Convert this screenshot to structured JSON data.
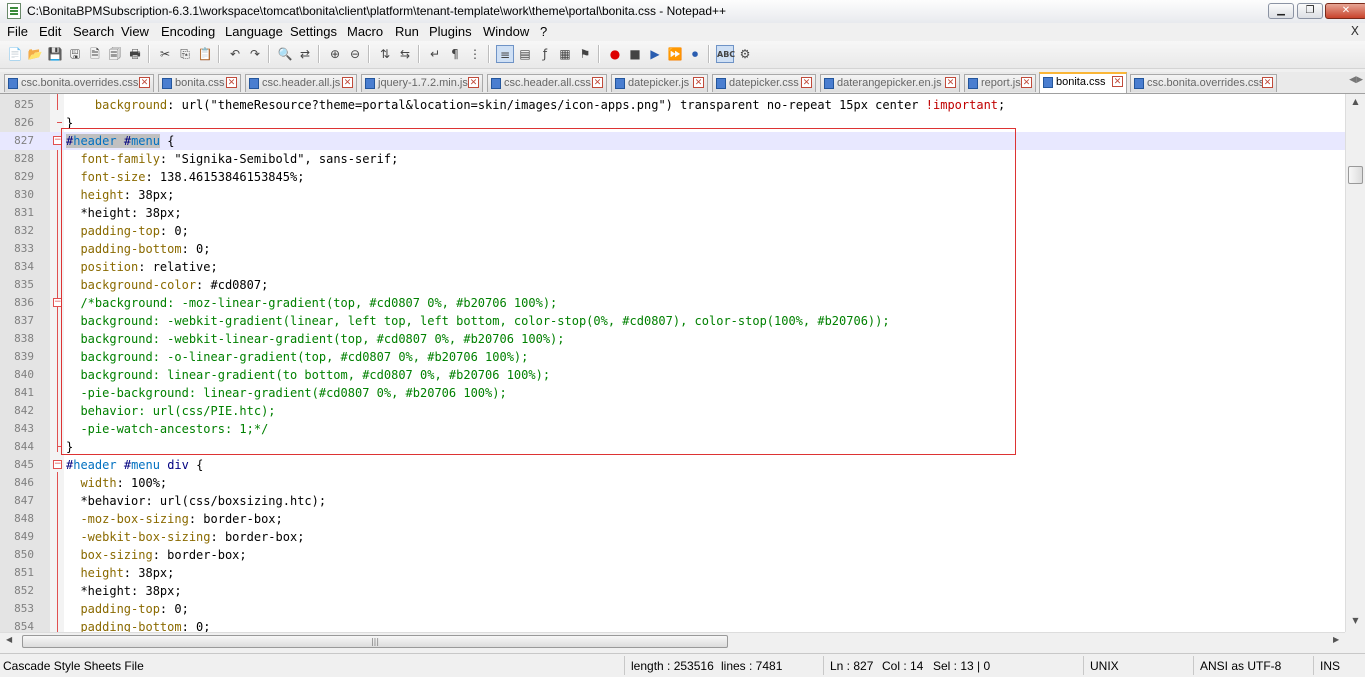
{
  "window": {
    "title": "C:\\BonitaBPMSubscription-6.3.1\\workspace\\tomcat\\bonita\\client\\platform\\tenant-template\\work\\theme\\portal\\bonita.css - Notepad++",
    "minimize": "▁",
    "maximize": "❐",
    "close": "✕"
  },
  "menu": [
    "File",
    "Edit",
    "Search",
    "View",
    "Encoding",
    "Language",
    "Settings",
    "Macro",
    "Run",
    "Plugins",
    "Window",
    "?"
  ],
  "menu_close": "X",
  "toolbar_icons": [
    "new-file-icon",
    "open-file-icon",
    "save-icon",
    "save-all-icon",
    "close-icon",
    "close-all-icon",
    "print-icon",
    "cut-icon",
    "copy-icon",
    "paste-icon",
    "undo-icon",
    "redo-icon",
    "find-icon",
    "replace-icon",
    "zoom-in-icon",
    "zoom-out-icon",
    "sync-vertical-icon",
    "sync-horizontal-icon",
    "word-wrap-icon",
    "show-all-chars-icon",
    "indent-guide-icon",
    "user-language-icon",
    "doc-map-icon",
    "function-list-icon",
    "record-macro-icon",
    "stop-record-icon",
    "play-macro-icon",
    "run-macro-multiple-icon",
    "save-macro-icon",
    "spellcheck-icon",
    "plugin-icon"
  ],
  "tabs": [
    {
      "label": "csc.bonita.overrides.css",
      "active": false
    },
    {
      "label": "bonita.css",
      "active": false
    },
    {
      "label": "csc.header.all.js",
      "active": false
    },
    {
      "label": "jquery-1.7.2.min.js",
      "active": false
    },
    {
      "label": "csc.header.all.css",
      "active": false
    },
    {
      "label": "datepicker.js",
      "active": false
    },
    {
      "label": "datepicker.css",
      "active": false
    },
    {
      "label": "daterangepicker.en.js",
      "active": false
    },
    {
      "label": "report.js",
      "active": false
    },
    {
      "label": "bonita.css",
      "active": true
    },
    {
      "label": "csc.bonita.overrides.css",
      "active": false
    }
  ],
  "editor": {
    "lines": [
      {
        "n": "825",
        "t": "    background: url(\"themeResource?theme=portal&location=skin/images/icon-apps.png\") transparent no-repeat 15px center !important;"
      },
      {
        "n": "826",
        "t": "}"
      },
      {
        "n": "827",
        "t": "#header #menu {"
      },
      {
        "n": "828",
        "t": "    font-family: \"Signika-Semibold\", sans-serif;"
      },
      {
        "n": "829",
        "t": "    font-size: 138.461538461538 45%;"
      },
      {
        "n": "830",
        "t": "    height: 38px;"
      },
      {
        "n": "831",
        "t": "    *height: 38px;"
      },
      {
        "n": "832",
        "t": "    padding-top: 0;"
      },
      {
        "n": "833",
        "t": "    padding-bottom: 0;"
      },
      {
        "n": "834",
        "t": "    position: relative;"
      },
      {
        "n": "835",
        "t": "    background-color: #cd0807;"
      },
      {
        "n": "836",
        "t": "    /*background: -moz-linear-gradient(top, #cd0807 0%, #b20706 100%);"
      },
      {
        "n": "837",
        "t": "    background: -webkit-gradient(linear, left top, left bottom, color-stop(0%, #cd0807), color-stop(100%, #b20706));"
      },
      {
        "n": "838",
        "t": "    background: -webkit-linear-gradient(top, #cd0807 0%, #b20706 100%);"
      },
      {
        "n": "839",
        "t": "    background: -o-linear-gradient(top, #cd0807 0%, #b20706 100%);"
      },
      {
        "n": "840",
        "t": "    background: linear-gradient(to bottom, #cd0807 0%, #b20706 100%);"
      },
      {
        "n": "841",
        "t": "    -pie-background: linear-gradient(#cd0807 0%, #b20706 100%);"
      },
      {
        "n": "842",
        "t": "    behavior: url(css/PIE.htc);"
      },
      {
        "n": "843",
        "t": "    -pie-watch-ancestors: 1;*/"
      },
      {
        "n": "844",
        "t": "}"
      },
      {
        "n": "845",
        "t": "#header #menu div {"
      },
      {
        "n": "846",
        "t": "    width: 100%;"
      },
      {
        "n": "847",
        "t": "    *behavior: url(css/boxsizing.htc);"
      },
      {
        "n": "848",
        "t": "    -moz-box-sizing: border-box;"
      },
      {
        "n": "849",
        "t": "    -webkit-box-sizing: border-box;"
      },
      {
        "n": "850",
        "t": "    box-sizing: border-box;"
      },
      {
        "n": "851",
        "t": "    height: 38px;"
      },
      {
        "n": "852",
        "t": "    *height: 38px;"
      },
      {
        "n": "853",
        "t": "    padding-top: 0;"
      },
      {
        "n": "854",
        "t": "    padding-bottom: 0;"
      }
    ]
  },
  "statusbar": {
    "file_type": "Cascade Style Sheets File",
    "length": "length : 253516",
    "lines": "lines : 7481",
    "ln": "Ln : 827",
    "col": "Col : 14",
    "sel": "Sel : 13 | 0",
    "eol": "UNIX",
    "encoding": "ANSI as UTF-8",
    "mode": "INS"
  }
}
